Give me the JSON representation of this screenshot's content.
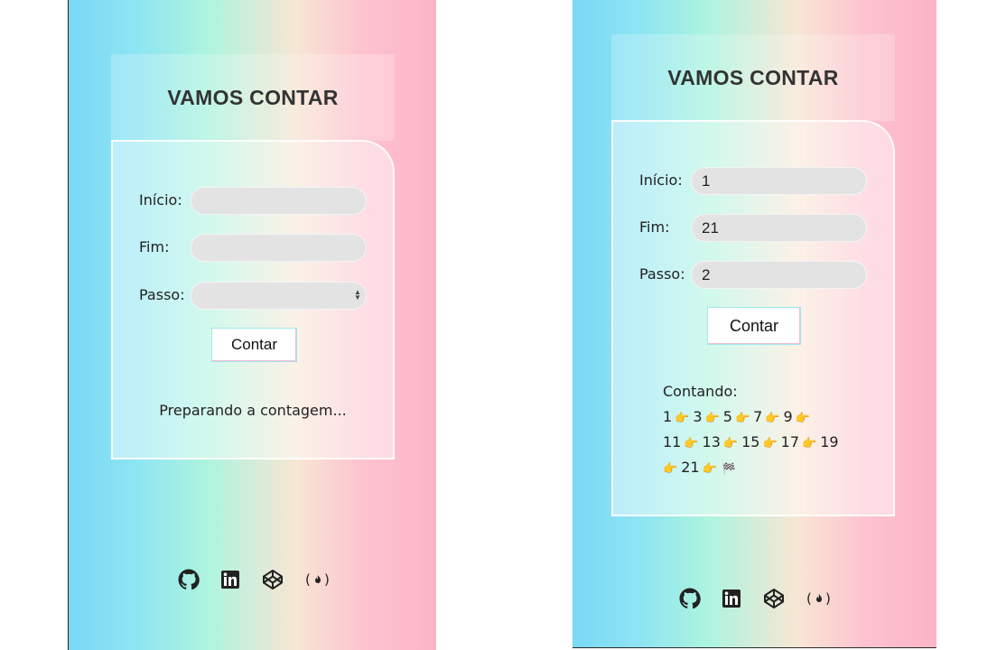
{
  "left_screen": {
    "title": "VAMOS CONTAR",
    "form": {
      "inicio_label": "Início:",
      "fim_label": "Fim:",
      "passo_label": "Passo:",
      "inicio_value": "",
      "fim_value": "",
      "passo_value": ""
    },
    "button_label": "Contar",
    "status_text": "Preparando a contagem..."
  },
  "right_screen": {
    "title": "VAMOS CONTAR",
    "form": {
      "inicio_label": "Início:",
      "fim_label": "Fim:",
      "passo_label": "Passo:",
      "inicio_value": "1",
      "fim_value": "21",
      "passo_value": "2"
    },
    "button_label": "Contar",
    "result_header": "Contando:",
    "result_numbers": [
      "1",
      "3",
      "5",
      "7",
      "9",
      "11",
      "13",
      "15",
      "17",
      "19",
      "21"
    ]
  },
  "footer_icons": [
    "github-icon",
    "linkedin-icon",
    "codepen-icon",
    "freecodecamp-icon"
  ],
  "colors": {
    "gradient_cyan": "#7ad8f6",
    "gradient_mint": "#aef4de",
    "gradient_peach": "#f8e6d4",
    "gradient_pink": "#fdb4c7",
    "input_bg": "#e3e3e3"
  }
}
